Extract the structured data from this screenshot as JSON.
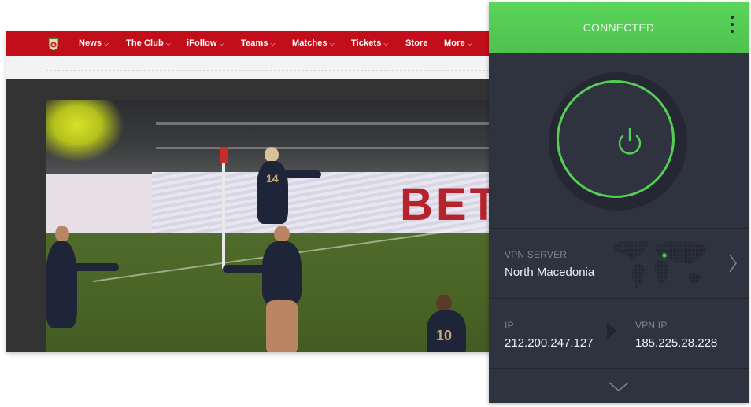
{
  "website": {
    "nav": {
      "logo": "club-crest-icon",
      "items": [
        {
          "label": "News",
          "has_dropdown": true
        },
        {
          "label": "The Club",
          "has_dropdown": true
        },
        {
          "label": "iFollow",
          "has_dropdown": true
        },
        {
          "label": "Teams",
          "has_dropdown": true
        },
        {
          "label": "Matches",
          "has_dropdown": true
        },
        {
          "label": "Tickets",
          "has_dropdown": true
        },
        {
          "label": "Store",
          "has_dropdown": false
        },
        {
          "label": "More",
          "has_dropdown": true
        }
      ],
      "dropdown_glyph": "⌵"
    },
    "video": {
      "hoarding_text": "BET",
      "shirt_numbers": [
        "14",
        "10"
      ]
    },
    "colors": {
      "nav_red": "#c20e1a"
    }
  },
  "vpn": {
    "status": "CONNECTED",
    "menu_icon": "kebab-menu-icon",
    "power_icon": "power-icon",
    "server": {
      "label": "VPN SERVER",
      "value": "North Macedonia"
    },
    "ip": {
      "label": "IP",
      "value": "212.200.247.127"
    },
    "vpn_ip": {
      "label": "VPN IP",
      "value": "185.225.28.228"
    },
    "colors": {
      "connected_green": "#54cf54",
      "panel_bg": "#2f3340"
    }
  }
}
